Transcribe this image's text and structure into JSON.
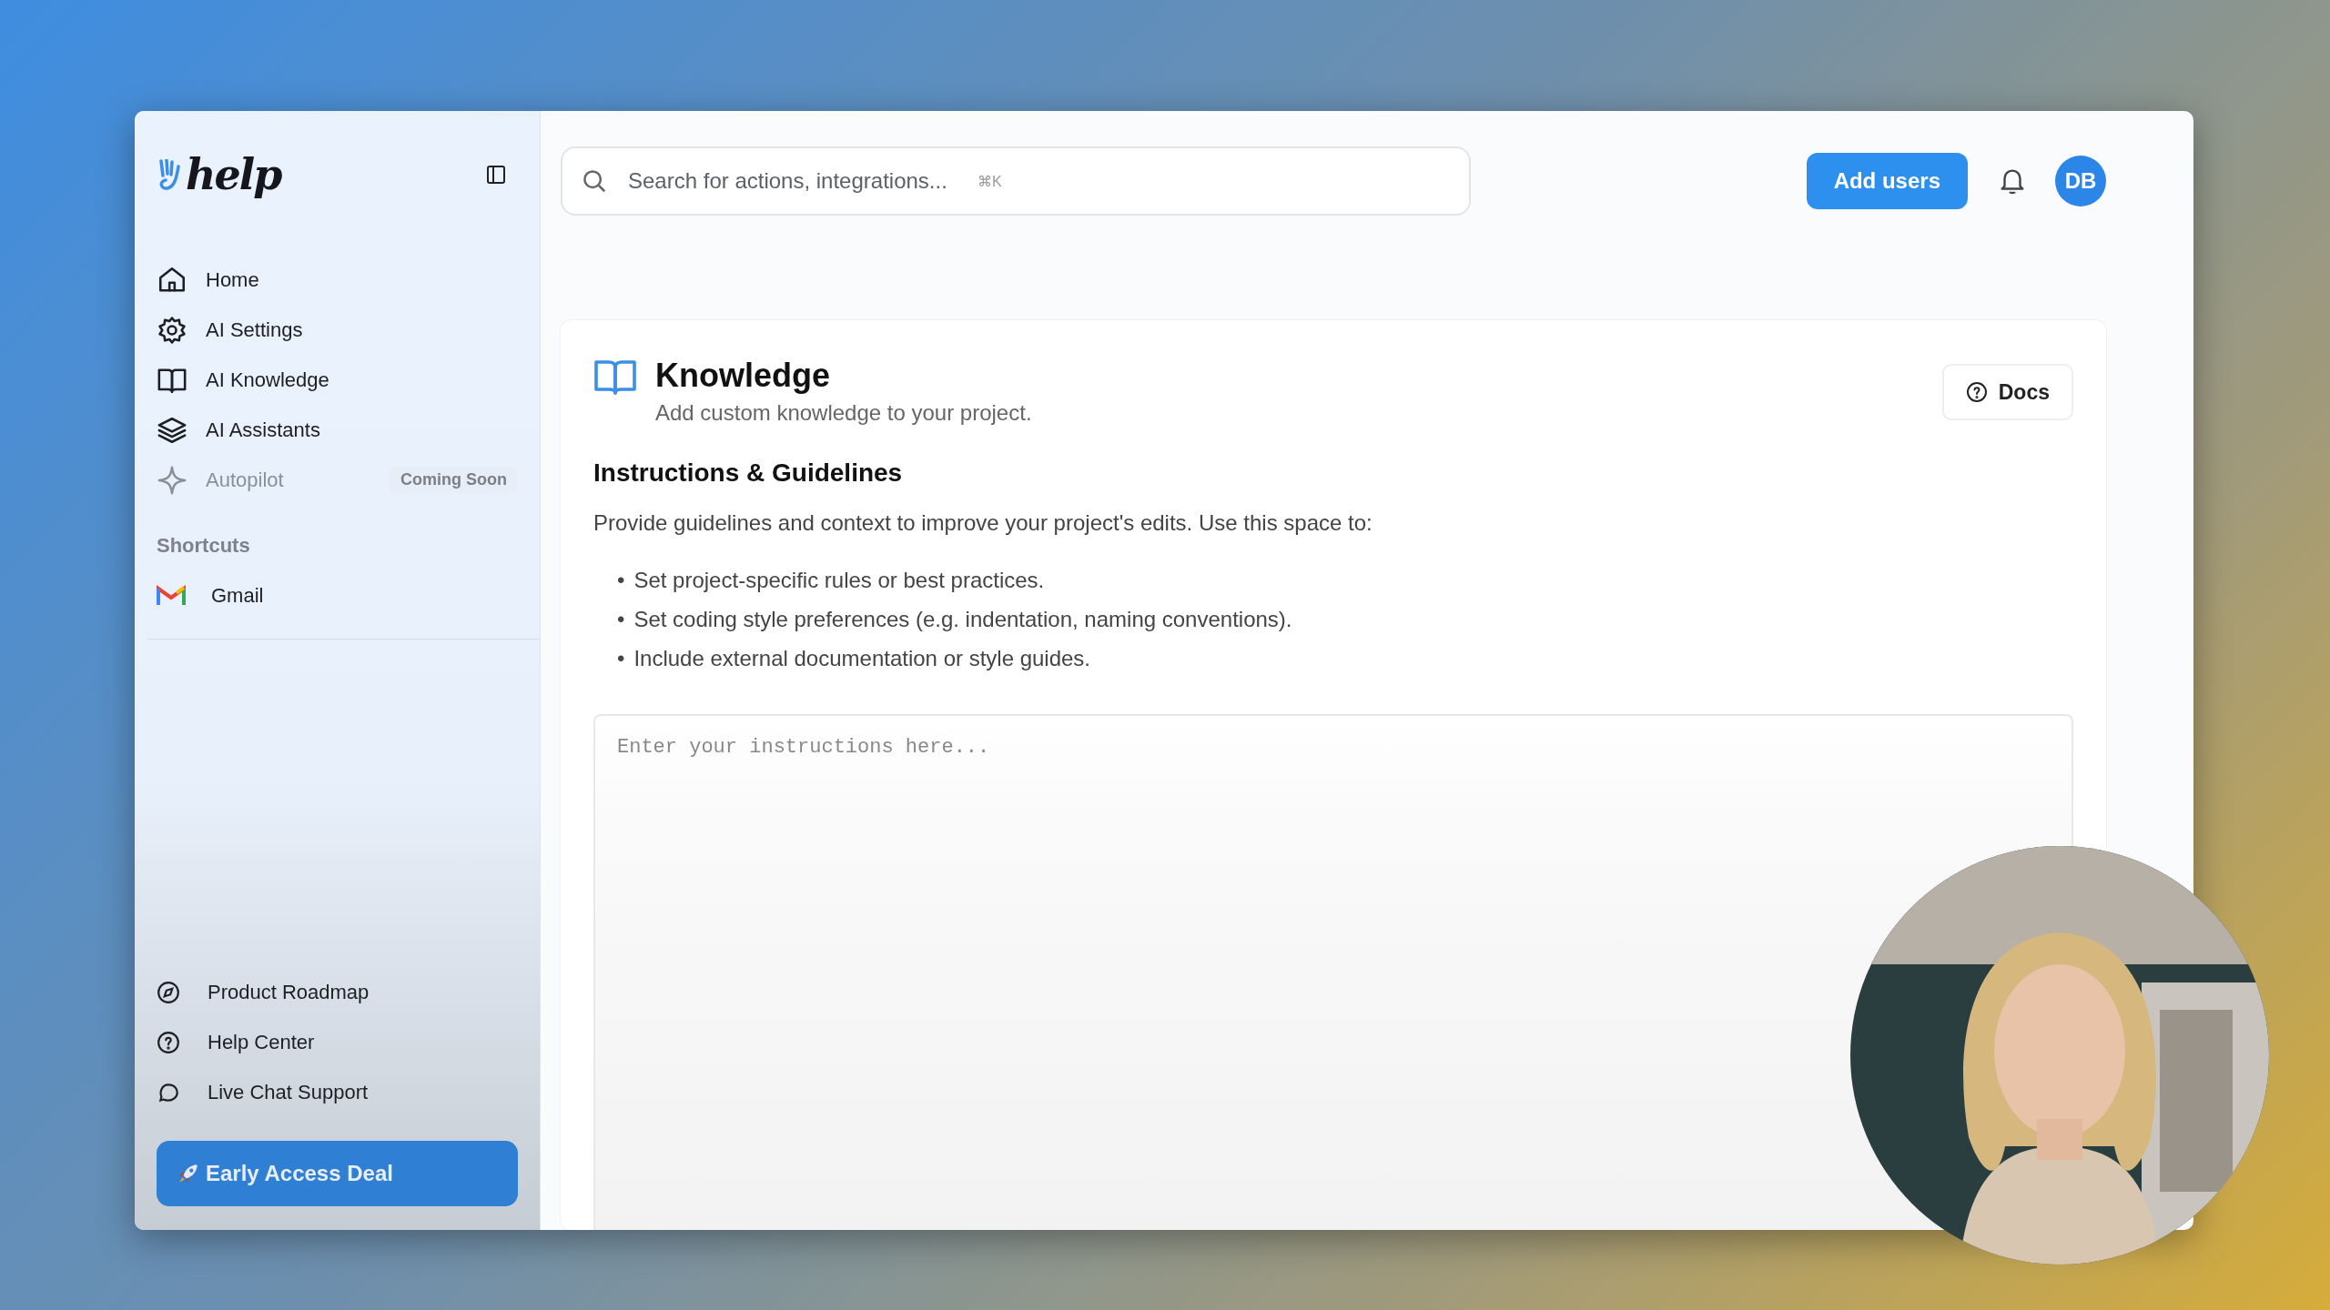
{
  "sidebar": {
    "logo": "help",
    "nav": [
      {
        "label": "Home",
        "disabled": false
      },
      {
        "label": "AI Settings",
        "disabled": false
      },
      {
        "label": "AI Knowledge",
        "disabled": false
      },
      {
        "label": "AI Assistants",
        "disabled": false
      },
      {
        "label": "Autopilot",
        "disabled": true,
        "badge": "Coming Soon"
      }
    ],
    "shortcuts_heading": "Shortcuts",
    "shortcuts": [
      {
        "label": "Gmail"
      }
    ],
    "footer_links": [
      {
        "label": "Product Roadmap"
      },
      {
        "label": "Help Center"
      },
      {
        "label": "Live Chat Support"
      }
    ],
    "deal_button": "Early Access Deal"
  },
  "header": {
    "search": {
      "placeholder": "Search for actions, integrations...",
      "shortcut": "⌘K"
    },
    "add_users": "Add users",
    "avatar": "DB"
  },
  "page": {
    "title": "Knowledge",
    "subtitle": "Add custom knowledge to your project.",
    "docs_button": "Docs",
    "section_title": "Instructions & Guidelines",
    "intro": "Provide guidelines and context to improve your project's edits. Use this space to:",
    "bullets": [
      {
        "marker": "•",
        "text": "Set project-specific rules or best practices."
      },
      {
        "marker": "•",
        "text": "Set coding style preferences (e.g. indentation, naming conventions)."
      },
      {
        "marker": "•",
        "text": "Include external documentation or style guides."
      }
    ],
    "instructions": {
      "placeholder": "Enter your instructions here..."
    }
  }
}
